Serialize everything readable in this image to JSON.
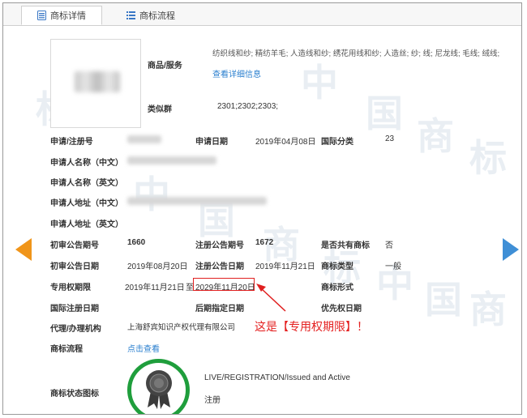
{
  "tabs": [
    {
      "label": "商标详情",
      "icon": "document-icon",
      "active": true
    },
    {
      "label": "商标流程",
      "icon": "list-icon",
      "active": false
    }
  ],
  "watermark": [
    "中",
    "国",
    "商",
    "标",
    "中",
    "国",
    "商",
    "标",
    "中",
    "国",
    "商",
    "标"
  ],
  "goods": {
    "label": "商品/服务",
    "value": "纺织线和纱; 精纺羊毛; 人造线和纱; 绣花用线和纱; 人造丝; 纱; 线; 尼龙线; 毛线; 绒线;",
    "link": "查看详细信息"
  },
  "similar_group": {
    "label": "类似群",
    "value": "2301;2302;2303;"
  },
  "fields": {
    "reg_no": {
      "label": "申请/注册号"
    },
    "app_date": {
      "label": "申请日期",
      "value": "2019年04月08日"
    },
    "intl_class": {
      "label": "国际分类",
      "value": "23"
    },
    "applicant_cn": {
      "label": "申请人名称（中文）"
    },
    "applicant_en": {
      "label": "申请人名称（英文）"
    },
    "address_cn": {
      "label": "申请人地址（中文）"
    },
    "address_en": {
      "label": "申请人地址（英文）"
    },
    "prelim_no": {
      "label": "初审公告期号",
      "value": "1660"
    },
    "reg_pub_no": {
      "label": "注册公告期号",
      "value": "1672"
    },
    "shared": {
      "label": "是否共有商标",
      "value": "否"
    },
    "prelim_date": {
      "label": "初审公告日期",
      "value": "2019年08月20日"
    },
    "reg_pub_date": {
      "label": "注册公告日期",
      "value": "2019年11月21日"
    },
    "mark_type": {
      "label": "商标类型",
      "value": "一般"
    },
    "exclusive": {
      "label": "专用权期限",
      "start": "2019年11月21日",
      "sep": "至",
      "end": "2029年11月20日"
    },
    "mark_form": {
      "label": "商标形式"
    },
    "intl_reg_date": {
      "label": "国际注册日期"
    },
    "later_date": {
      "label": "后期指定日期"
    },
    "priority_date": {
      "label": "优先权日期"
    },
    "agent": {
      "label": "代理/办理机构",
      "value": "上海舒宾知识产权代理有限公司"
    },
    "process": {
      "label": "商标流程",
      "link": "点击查看"
    },
    "status_icon": {
      "label": "商标状态图标",
      "status_en": "LIVE/REGISTRATION/Issued and Active",
      "status_cn": "注册"
    }
  },
  "annotation": "这是【专用权期限】！",
  "colors": {
    "accent_link": "#2a7fcf",
    "left_arrow": "#f0951a",
    "right_arrow": "#3f8fd6",
    "highlight": "#e02020",
    "status_ring": "#1f9e3c"
  }
}
